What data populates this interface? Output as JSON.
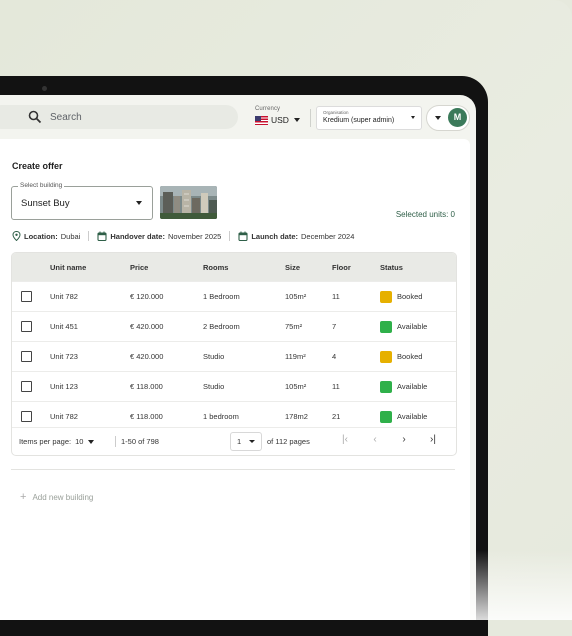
{
  "header": {
    "search_placeholder": "Search",
    "currency": {
      "label": "Currency",
      "value": "USD"
    },
    "organisation": {
      "label": "Organisation",
      "value": "Kredium (super admin)"
    },
    "user_initial": "M"
  },
  "page": {
    "title": "Create offer",
    "select_building": {
      "label": "Select building",
      "value": "Sunset Buy"
    },
    "selected_units": "Selected units: 0",
    "location_key": "Location:",
    "location_value": "Dubai",
    "handover_key": "Handover date:",
    "handover_value": "November 2025",
    "launch_key": "Launch date:",
    "launch_value": "December 2024"
  },
  "table": {
    "columns": [
      "Unit name",
      "Price",
      "Rooms",
      "Size",
      "Floor",
      "Status"
    ],
    "rows": [
      {
        "unit": "Unit 782",
        "price": "€ 120.000",
        "rooms": "1 Bedroom",
        "size": "105m²",
        "floor": "11",
        "status": "Booked"
      },
      {
        "unit": "Unit 451",
        "price": "€ 420.000",
        "rooms": "2 Bedroom",
        "size": "75m²",
        "floor": "7",
        "status": "Available"
      },
      {
        "unit": "Unit 723",
        "price": "€ 420.000",
        "rooms": "Studio",
        "size": "119m²",
        "floor": "4",
        "status": "Booked"
      },
      {
        "unit": "Unit 123",
        "price": "€ 118.000",
        "rooms": "Studio",
        "size": "105m²",
        "floor": "11",
        "status": "Available"
      },
      {
        "unit": "Unit 782",
        "price": "€ 118.000",
        "rooms": "1 bedroom",
        "size": "178m2",
        "floor": "21",
        "status": "Available"
      }
    ],
    "footer": {
      "items_per_page_label": "Items per page:",
      "items_per_page_value": "10",
      "range": "1-50 of 798",
      "page": "1",
      "of_pages": "of 112 pages"
    }
  },
  "add_building": "Add new building",
  "colors": {
    "booked": "#e6b000",
    "available": "#2fb04a",
    "accent": "#2f5f48"
  }
}
